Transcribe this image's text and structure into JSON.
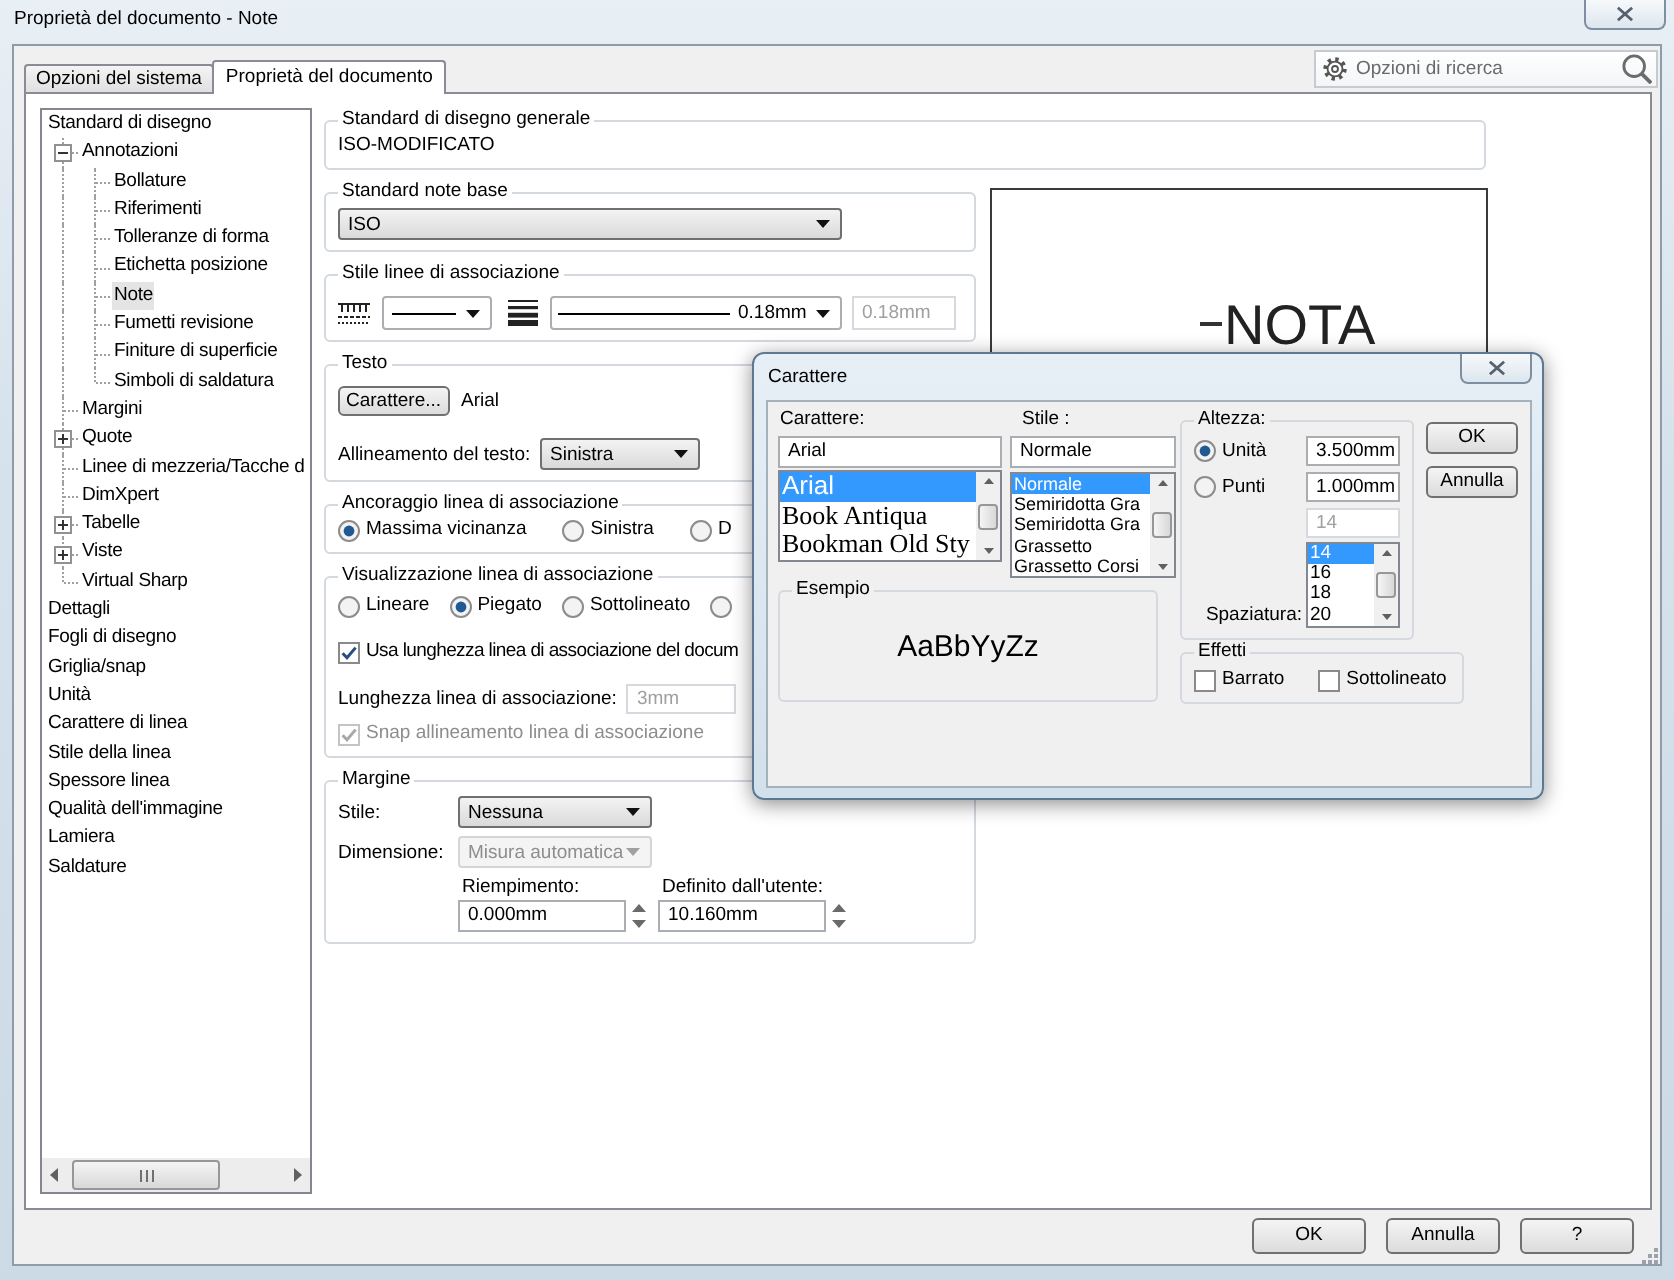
{
  "window": {
    "title": "Proprietà del documento - Note"
  },
  "tabs": [
    {
      "label": "Opzioni del sistema",
      "selected": false
    },
    {
      "label": "Proprietà del documento",
      "selected": true
    }
  ],
  "search": {
    "placeholder": "Opzioni di ricerca"
  },
  "tree": {
    "items": [
      {
        "label": "Standard di disegno",
        "selected": false,
        "children": [
          {
            "label": "Annotazioni",
            "selected": false,
            "expanded": true,
            "children": [
              {
                "label": "Bollature",
                "selected": false
              },
              {
                "label": "Riferimenti",
                "selected": false
              },
              {
                "label": "Tolleranze di forma",
                "selected": false
              },
              {
                "label": "Etichetta posizione",
                "selected": false
              },
              {
                "label": "Note",
                "selected": true
              },
              {
                "label": "Fumetti revisione",
                "selected": false
              },
              {
                "label": "Finiture di superficie",
                "selected": false
              },
              {
                "label": "Simboli di saldatura",
                "selected": false
              }
            ]
          },
          {
            "label": "Margini",
            "selected": false
          },
          {
            "label": "Quote",
            "selected": false,
            "expanded": false
          },
          {
            "label": "Linee di mezzeria/Tacche d",
            "selected": false
          },
          {
            "label": "DimXpert",
            "selected": false
          },
          {
            "label": "Tabelle",
            "selected": false,
            "expanded": false
          },
          {
            "label": "Viste",
            "selected": false,
            "expanded": false
          },
          {
            "label": "Virtual Sharp",
            "selected": false
          }
        ]
      },
      {
        "label": "Dettagli",
        "selected": false
      },
      {
        "label": "Fogli di disegno",
        "selected": false
      },
      {
        "label": "Griglia/snap",
        "selected": false
      },
      {
        "label": "Unità",
        "selected": false
      },
      {
        "label": "Carattere di linea",
        "selected": false
      },
      {
        "label": "Stile della linea",
        "selected": false
      },
      {
        "label": "Spessore linea",
        "selected": false
      },
      {
        "label": "Qualità dell'immagine",
        "selected": false
      },
      {
        "label": "Lamiera",
        "selected": false
      },
      {
        "label": "Saldature",
        "selected": false
      }
    ]
  },
  "general_standard": {
    "label": "Standard di disegno generale",
    "value": "ISO-MODIFICATO"
  },
  "note_standard": {
    "label": "Standard note base",
    "value": "ISO"
  },
  "leader_style": {
    "label": "Stile linee di associazione",
    "thickness": "0.18mm",
    "custom_thickness": {
      "value": "0.18mm",
      "disabled": true
    }
  },
  "text": {
    "label": "Testo",
    "font_button": "Carattere...",
    "font": "Arial",
    "alignment_label": "Allineamento del testo:",
    "alignment": "Sinistra"
  },
  "leader_anchor": {
    "label": "Ancoraggio linea di associazione",
    "options": [
      {
        "label": "Massima vicinanza",
        "selected": true
      },
      {
        "label": "Sinistra",
        "selected": false
      },
      {
        "label": "D",
        "selected": false
      }
    ]
  },
  "leader_display": {
    "label": "Visualizzazione linea di associazione",
    "options": [
      {
        "label": "Lineare",
        "selected": false
      },
      {
        "label": "Piegato",
        "selected": true
      },
      {
        "label": "Sottolineato",
        "selected": false
      },
      {
        "selected": false
      }
    ],
    "document_length": {
      "label": "Usa lunghezza linea di associazione del docum",
      "checked": true
    },
    "length": {
      "label": "Lunghezza linea di associazione:",
      "value": "3mm",
      "disabled": true
    },
    "snap": {
      "label": "Snap allineamento linea di associazione",
      "checked": true,
      "disabled": true
    }
  },
  "border": {
    "label": "Margine",
    "style": {
      "label": "Stile:",
      "value": "Nessuna"
    },
    "size": {
      "label": "Dimensione:",
      "value": "Misura automatica",
      "disabled": true
    },
    "padding": {
      "label": "Riempimento:",
      "value": "0.000mm"
    },
    "user_defined": {
      "label": "Definito dall'utente:",
      "value": "10.160mm"
    }
  },
  "preview": {
    "note": "NOTA"
  },
  "font_dialog": {
    "title": "Carattere",
    "font": {
      "label": "Carattere:",
      "value": "Arial",
      "options": [
        {
          "label": "Arial",
          "selected": true,
          "kind": "sans"
        },
        {
          "label": "Book Antiqua",
          "selected": false,
          "kind": "serif"
        },
        {
          "label": "Bookman Old Sty",
          "selected": false,
          "kind": "serif"
        }
      ]
    },
    "style": {
      "label": "Stile :",
      "value": "Normale",
      "options": [
        {
          "label": "Normale",
          "selected": true
        },
        {
          "label": "Semiridotta Gra",
          "selected": false
        },
        {
          "label": "Semiridotta Gra",
          "selected": false
        },
        {
          "label": "Grassetto",
          "selected": false
        },
        {
          "label": "Grassetto Corsi",
          "selected": false
        }
      ]
    },
    "height": {
      "label": "Altezza:",
      "units": [
        {
          "label": "Unità",
          "selected": true,
          "value": "3.500mm"
        },
        {
          "label": "Punti",
          "selected": false,
          "value": "1.000mm"
        }
      ],
      "points": {
        "value": "14",
        "disabled": true
      },
      "spacing_label": "Spaziatura:",
      "sizes": [
        {
          "label": "14",
          "selected": true
        },
        {
          "label": "16",
          "selected": false
        },
        {
          "label": "18",
          "selected": false
        },
        {
          "label": "20",
          "selected": false
        }
      ]
    },
    "sample": {
      "label": "Esempio",
      "text": "AaBbYyZz"
    },
    "effects": {
      "label": "Effetti",
      "options": [
        {
          "label": "Barrato",
          "checked": false
        },
        {
          "label": "Sottolineato",
          "checked": false
        }
      ]
    },
    "buttons": [
      {
        "label": "OK"
      },
      {
        "label": "Annulla"
      }
    ]
  },
  "buttons": [
    {
      "label": "OK"
    },
    {
      "label": "Annulla"
    },
    {
      "label": "?"
    }
  ]
}
